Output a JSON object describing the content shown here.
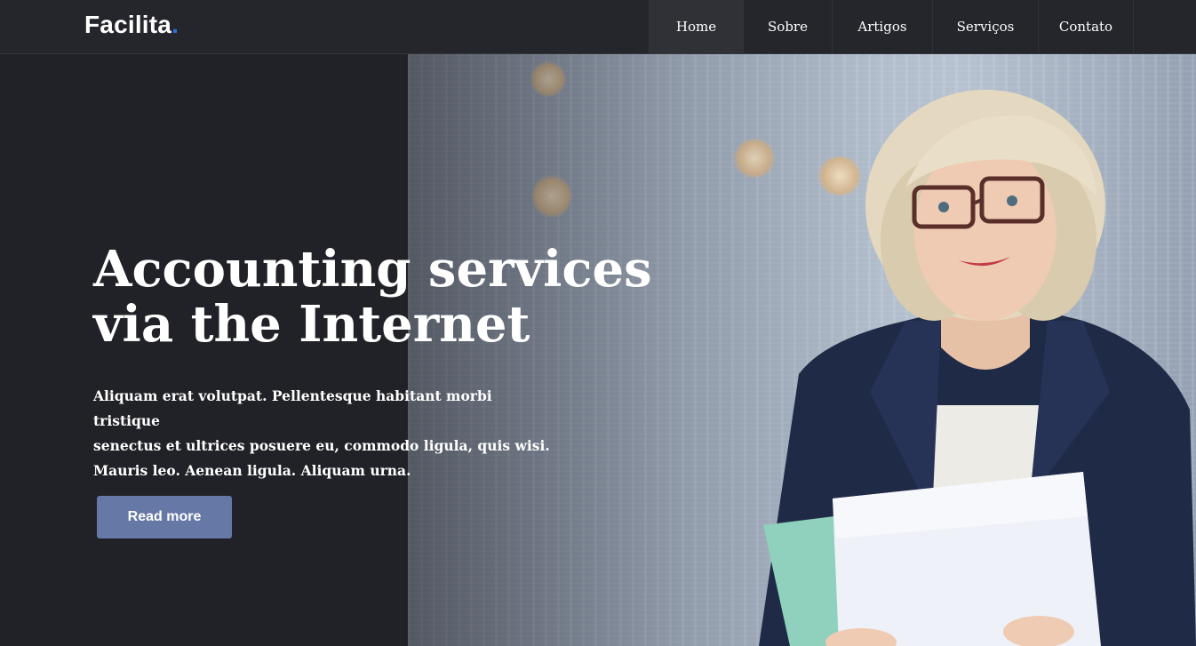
{
  "header": {
    "logo_text": "Facilita",
    "logo_dot": ".",
    "nav": [
      {
        "label": "Home",
        "active": true
      },
      {
        "label": "Sobre",
        "active": false
      },
      {
        "label": "Artigos",
        "active": false
      },
      {
        "label": "Serviços",
        "active": false
      },
      {
        "label": "Contato",
        "active": false
      }
    ]
  },
  "hero": {
    "title_line1": "Accounting services",
    "title_line2": "via the Internet",
    "description_line1": "Aliquam erat volutpat. Pellentesque habitant morbi tristique",
    "description_line2": "senectus et ultrices posuere eu, commodo ligula, quis wisi.",
    "description_line3": "Mauris leo. Aenean ligula. Aliquam urna.",
    "button_label": "Read more",
    "image_subject": "smiling woman in navy blazer holding papers in office"
  },
  "colors": {
    "background": "#212227",
    "accent_dot": "#2f6fe0",
    "button": "#6678a5"
  }
}
